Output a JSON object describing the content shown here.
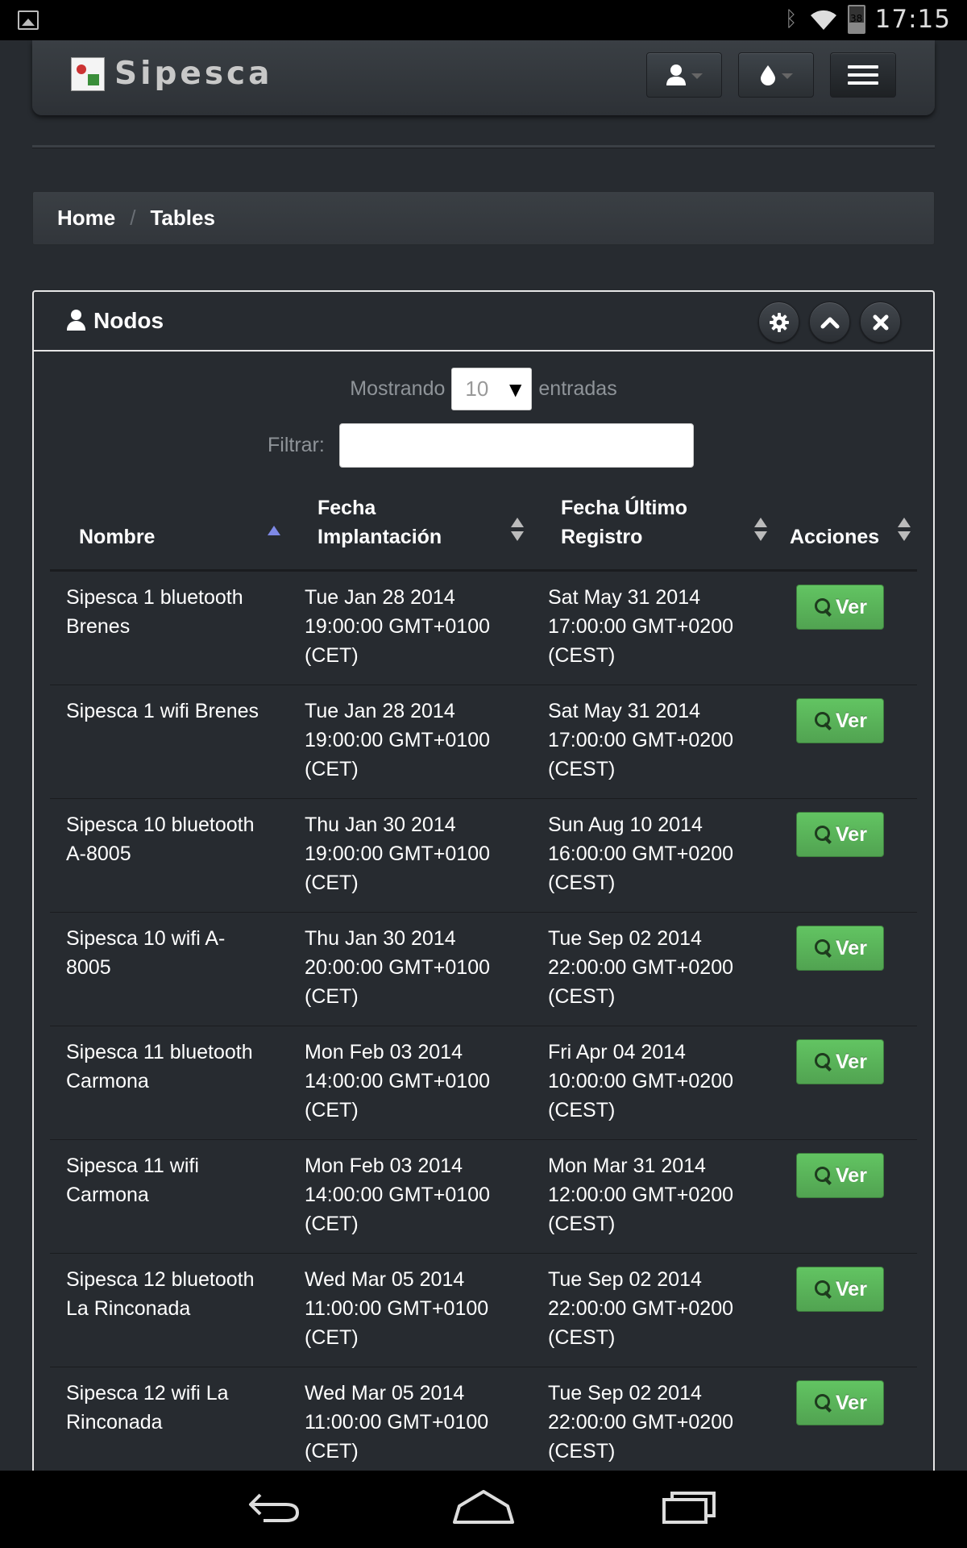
{
  "status_bar": {
    "time": "17:15",
    "battery_level": "38",
    "icons": [
      "gallery-icon",
      "bluetooth-icon",
      "wifi-icon",
      "battery-icon"
    ]
  },
  "navbar": {
    "brand": "Sipesca",
    "buttons": [
      "user-icon",
      "theme-icon",
      "menu-icon"
    ]
  },
  "breadcrumb": {
    "home": "Home",
    "current": "Tables"
  },
  "box": {
    "title": "Nodos",
    "header_buttons": [
      "gear-icon",
      "chevron-up-icon",
      "close-icon"
    ]
  },
  "controls": {
    "length_prefix": "Mostrando",
    "length_value": "10",
    "length_suffix": "entradas",
    "filter_label": "Filtrar:",
    "filter_value": ""
  },
  "table": {
    "headers": {
      "name": "Nombre",
      "fi_line1": "Fecha",
      "fi_line2": "Implantación",
      "fu_line1": "Fecha Último",
      "fu_line2": "Registro",
      "actions": "Acciones"
    },
    "action_label": "Ver",
    "rows": [
      {
        "name_1": "Sipesca 1 bluetooth",
        "name_2": "Brenes",
        "fi_1": "Tue Jan 28 2014",
        "fi_2": "19:00:00 GMT+0100",
        "fi_3": "(CET)",
        "fu_1": "Sat May 31 2014",
        "fu_2": "17:00:00 GMT+0200",
        "fu_3": "(CEST)"
      },
      {
        "name_1": "Sipesca 1 wifi Brenes",
        "name_2": "",
        "fi_1": "Tue Jan 28 2014",
        "fi_2": "19:00:00 GMT+0100",
        "fi_3": "(CET)",
        "fu_1": "Sat May 31 2014",
        "fu_2": "17:00:00 GMT+0200",
        "fu_3": "(CEST)"
      },
      {
        "name_1": "Sipesca 10 bluetooth",
        "name_2": "A-8005",
        "fi_1": "Thu Jan 30 2014",
        "fi_2": "19:00:00 GMT+0100",
        "fi_3": "(CET)",
        "fu_1": "Sun Aug 10 2014",
        "fu_2": "16:00:00 GMT+0200",
        "fu_3": "(CEST)"
      },
      {
        "name_1": "Sipesca 10 wifi A-",
        "name_2": "8005",
        "fi_1": "Thu Jan 30 2014",
        "fi_2": "20:00:00 GMT+0100",
        "fi_3": "(CET)",
        "fu_1": "Tue Sep 02 2014",
        "fu_2": "22:00:00 GMT+0200",
        "fu_3": "(CEST)"
      },
      {
        "name_1": "Sipesca 11 bluetooth",
        "name_2": "Carmona",
        "fi_1": "Mon Feb 03 2014",
        "fi_2": "14:00:00 GMT+0100",
        "fi_3": "(CET)",
        "fu_1": "Fri Apr 04 2014",
        "fu_2": "10:00:00 GMT+0200",
        "fu_3": "(CEST)"
      },
      {
        "name_1": "Sipesca 11 wifi",
        "name_2": "Carmona",
        "fi_1": "Mon Feb 03 2014",
        "fi_2": "14:00:00 GMT+0100",
        "fi_3": "(CET)",
        "fu_1": "Mon Mar 31 2014",
        "fu_2": "12:00:00 GMT+0200",
        "fu_3": "(CEST)"
      },
      {
        "name_1": "Sipesca 12 bluetooth",
        "name_2": "La Rinconada",
        "fi_1": "Wed Mar 05 2014",
        "fi_2": "11:00:00 GMT+0100",
        "fi_3": "(CET)",
        "fu_1": "Tue Sep 02 2014",
        "fu_2": "22:00:00 GMT+0200",
        "fu_3": "(CEST)"
      },
      {
        "name_1": "Sipesca 12 wifi La",
        "name_2": "Rinconada",
        "fi_1": "Wed Mar 05 2014",
        "fi_2": "11:00:00 GMT+0100",
        "fi_3": "(CET)",
        "fu_1": "Tue Sep 02 2014",
        "fu_2": "22:00:00 GMT+0200",
        "fu_3": "(CEST)"
      }
    ]
  },
  "system_nav": [
    "back-icon",
    "home-icon",
    "recent-apps-icon"
  ],
  "colors": {
    "background": "#272b30",
    "accent_green": "#5bb75b",
    "sort_active": "#7e89e6"
  }
}
